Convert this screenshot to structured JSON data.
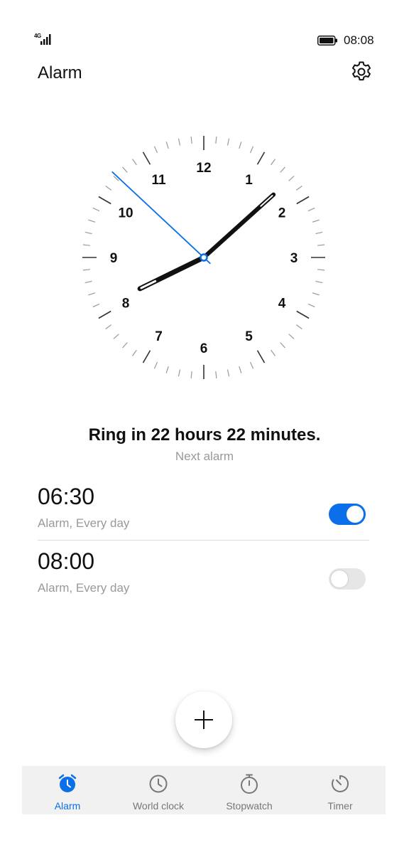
{
  "status_bar": {
    "network": "4G",
    "time": "08:08"
  },
  "header": {
    "title": "Alarm",
    "settings_icon": "gear-icon"
  },
  "clock": {
    "numbers": [
      "12",
      "1",
      "2",
      "3",
      "4",
      "5",
      "6",
      "7",
      "8",
      "9",
      "10",
      "11"
    ],
    "time": "08:08",
    "hand_color": "#111111",
    "second_hand_color": "#0a6fe8"
  },
  "next_alarm": {
    "ring_text": "Ring in 22 hours 22 minutes.",
    "label": "Next alarm"
  },
  "alarms": [
    {
      "time": "06:30",
      "subtitle": "Alarm, Every day",
      "enabled": true
    },
    {
      "time": "08:00",
      "subtitle": "Alarm, Every day",
      "enabled": false
    }
  ],
  "fab": {
    "icon": "plus-icon"
  },
  "bottom_nav": {
    "items": [
      {
        "label": "Alarm",
        "icon": "alarm-icon",
        "active": true
      },
      {
        "label": "World clock",
        "icon": "clock-icon",
        "active": false
      },
      {
        "label": "Stopwatch",
        "icon": "stopwatch-icon",
        "active": false
      },
      {
        "label": "Timer",
        "icon": "timer-icon",
        "active": false
      }
    ]
  },
  "colors": {
    "accent": "#0a6fe8",
    "toggle_off": "#e6e6e6",
    "nav_background": "#f1f1f1"
  }
}
